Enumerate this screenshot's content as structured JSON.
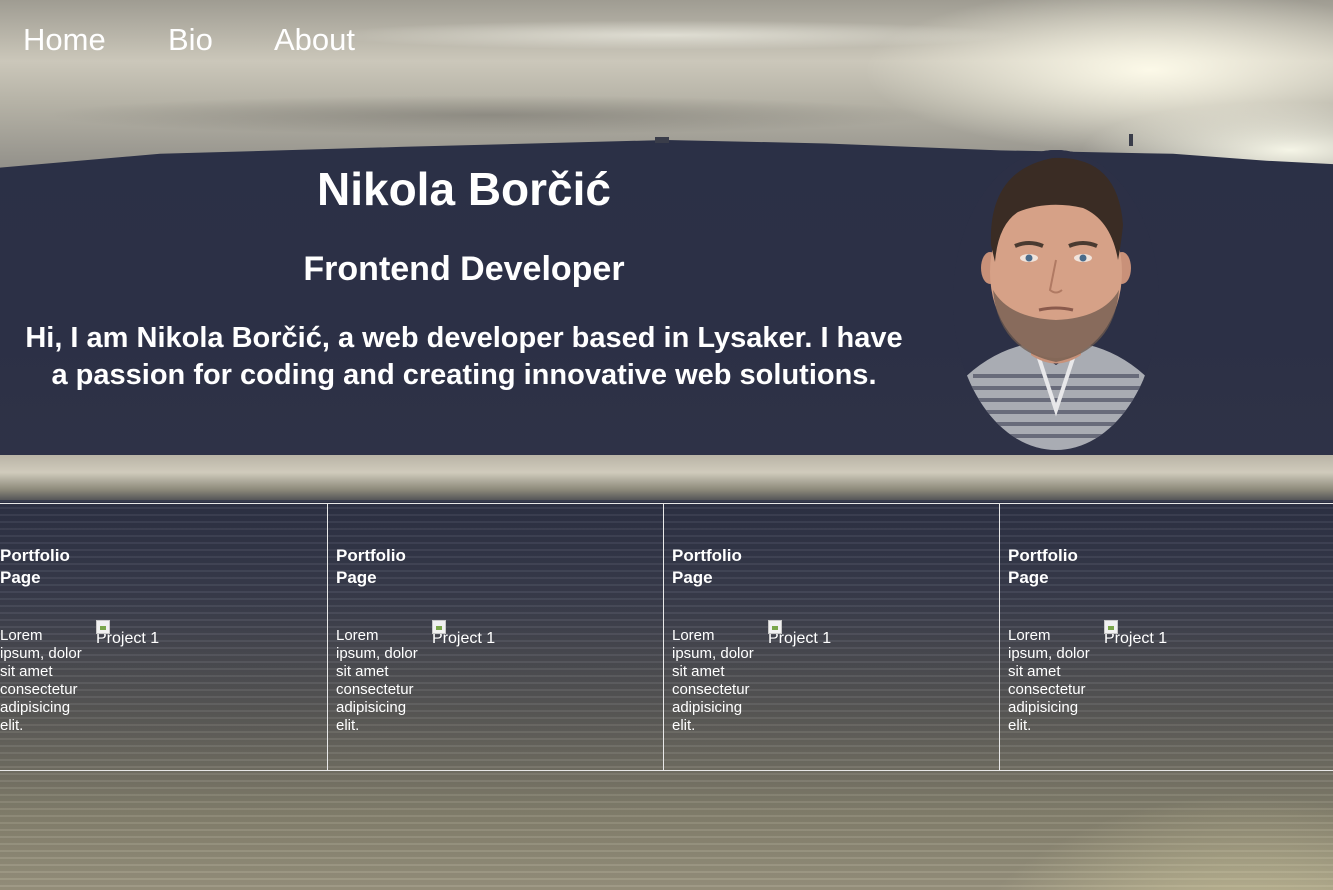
{
  "nav": {
    "items": [
      {
        "label": "Home"
      },
      {
        "label": "Bio"
      },
      {
        "label": "About"
      }
    ]
  },
  "hero": {
    "name": "Nikola Borčić",
    "role": "Frontend Developer",
    "intro": "Hi, I am Nikola Borčić, a web developer based in Lysaker. I have a passion for coding and creating innovative web solutions.",
    "photo_alt": "Nikola Borčić"
  },
  "portfolio": {
    "cards": [
      {
        "title": "Portfolio Page",
        "text": "Lorem ipsum, dolor sit amet consectetur adipisicing elit.",
        "image_alt": "Project 1"
      },
      {
        "title": "Portfolio Page",
        "text": "Lorem ipsum, dolor sit amet consectetur adipisicing elit.",
        "image_alt": "Project 1"
      },
      {
        "title": "Portfolio Page",
        "text": "Lorem ipsum, dolor sit amet consectetur adipisicing elit.",
        "image_alt": "Project 1"
      },
      {
        "title": "Portfolio Page",
        "text": "Lorem ipsum, dolor sit amet consectetur adipisicing elit.",
        "image_alt": "Project 1"
      }
    ]
  },
  "colors": {
    "text": "#ffffff",
    "divider": "#e8e8e8",
    "hill": "#2c3046"
  }
}
